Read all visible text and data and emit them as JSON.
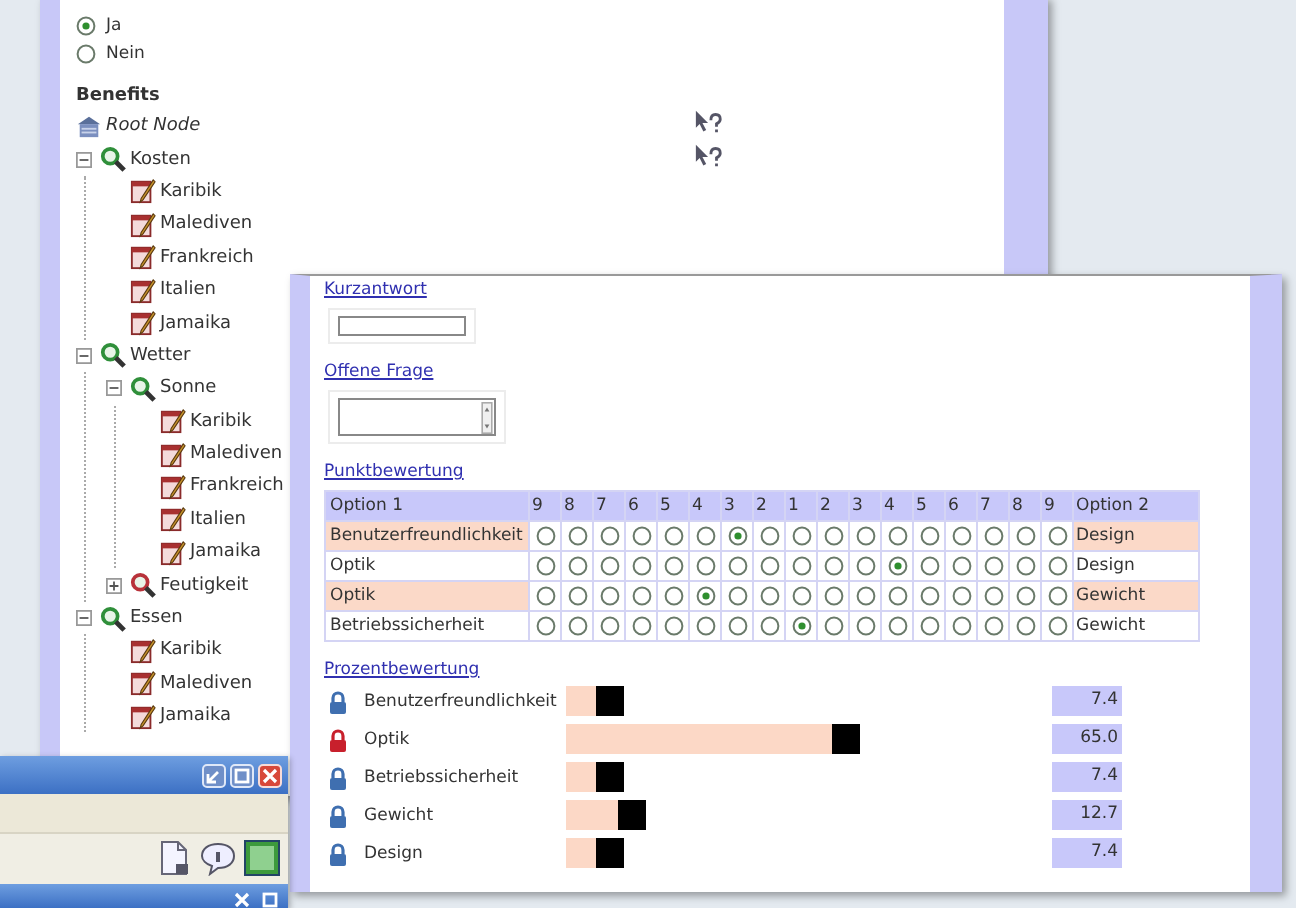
{
  "back_window": {
    "radios": [
      {
        "label": "Ja",
        "selected": true
      },
      {
        "label": "Nein",
        "selected": false
      }
    ],
    "tree": {
      "title": "Benefits",
      "root": {
        "label": "Root Node",
        "children": [
          {
            "kind": "category",
            "label": "Kosten",
            "expanded": true,
            "children": [
              {
                "kind": "item",
                "label": "Karibik"
              },
              {
                "kind": "item",
                "label": "Malediven"
              },
              {
                "kind": "item",
                "label": "Frankreich"
              },
              {
                "kind": "item",
                "label": "Italien"
              },
              {
                "kind": "item",
                "label": "Jamaika"
              }
            ]
          },
          {
            "kind": "category",
            "label": "Wetter",
            "expanded": true,
            "children": [
              {
                "kind": "category",
                "label": "Sonne",
                "expanded": true,
                "children": [
                  {
                    "kind": "item",
                    "label": "Karibik"
                  },
                  {
                    "kind": "item",
                    "label": "Malediven"
                  },
                  {
                    "kind": "item",
                    "label": "Frankreich"
                  },
                  {
                    "kind": "item",
                    "label": "Italien"
                  },
                  {
                    "kind": "item",
                    "label": "Jamaika"
                  }
                ]
              },
              {
                "kind": "category",
                "label": "Feutigkeit",
                "expanded": false
              }
            ]
          },
          {
            "kind": "category",
            "label": "Essen",
            "expanded": true,
            "children": [
              {
                "kind": "item",
                "label": "Karibik"
              },
              {
                "kind": "item",
                "label": "Malediven"
              },
              {
                "kind": "item",
                "label": "Jamaika"
              }
            ]
          }
        ]
      }
    }
  },
  "front_window": {
    "short_answer": {
      "label": "Kurzantwort"
    },
    "open_question": {
      "label": "Offene Frage"
    },
    "point_rating": {
      "title": "Punktbewertung",
      "columns": [
        "Option 1",
        "9",
        "8",
        "7",
        "6",
        "5",
        "4",
        "3",
        "2",
        "1",
        "2",
        "3",
        "4",
        "5",
        "6",
        "7",
        "8",
        "9",
        "Option 2"
      ],
      "rows": [
        {
          "option_1": "Benutzerfreundlichkeit",
          "option_2": "Design",
          "choices": [
            {
              "selected": false
            },
            {
              "selected": false
            },
            {
              "selected": false
            },
            {
              "selected": false
            },
            {
              "selected": false
            },
            {
              "selected": false
            },
            {
              "selected": true
            },
            {
              "selected": false
            },
            {
              "selected": false
            },
            {
              "selected": false
            },
            {
              "selected": false
            },
            {
              "selected": false
            },
            {
              "selected": false
            },
            {
              "selected": false
            },
            {
              "selected": false
            },
            {
              "selected": false
            },
            {
              "selected": false
            }
          ]
        },
        {
          "option_1": "Optik",
          "option_2": "Design",
          "choices": [
            {
              "selected": false
            },
            {
              "selected": false
            },
            {
              "selected": false
            },
            {
              "selected": false
            },
            {
              "selected": false
            },
            {
              "selected": false
            },
            {
              "selected": false
            },
            {
              "selected": false
            },
            {
              "selected": false
            },
            {
              "selected": false
            },
            {
              "selected": false
            },
            {
              "selected": true
            },
            {
              "selected": false
            },
            {
              "selected": false
            },
            {
              "selected": false
            },
            {
              "selected": false
            },
            {
              "selected": false
            }
          ]
        },
        {
          "option_1": "Optik",
          "option_2": "Gewicht",
          "choices": [
            {
              "selected": false
            },
            {
              "selected": false
            },
            {
              "selected": false
            },
            {
              "selected": false
            },
            {
              "selected": false
            },
            {
              "selected": true
            },
            {
              "selected": false
            },
            {
              "selected": false
            },
            {
              "selected": false
            },
            {
              "selected": false
            },
            {
              "selected": false
            },
            {
              "selected": false
            },
            {
              "selected": false
            },
            {
              "selected": false
            },
            {
              "selected": false
            },
            {
              "selected": false
            },
            {
              "selected": false
            }
          ]
        },
        {
          "option_1": "Betriebssicherheit",
          "option_2": "Gewicht",
          "choices": [
            {
              "selected": false
            },
            {
              "selected": false
            },
            {
              "selected": false
            },
            {
              "selected": false
            },
            {
              "selected": false
            },
            {
              "selected": false
            },
            {
              "selected": false
            },
            {
              "selected": false
            },
            {
              "selected": true
            },
            {
              "selected": false
            },
            {
              "selected": false
            },
            {
              "selected": false
            },
            {
              "selected": false
            },
            {
              "selected": false
            },
            {
              "selected": false
            },
            {
              "selected": false
            },
            {
              "selected": false
            }
          ]
        }
      ]
    },
    "percent_rating": {
      "title": "Prozentbewertung",
      "items": [
        {
          "label": "Benutzerfreundlichkeit",
          "color": "#3f6fb0",
          "level": 0.074,
          "value": "7.4"
        },
        {
          "label": "Optik",
          "color": "#c8202c",
          "level": 0.65,
          "value": "65.0"
        },
        {
          "label": "Betriebssicherheit",
          "color": "#3f6fb0",
          "level": 0.074,
          "value": "7.4"
        },
        {
          "label": "Gewicht",
          "color": "#3f6fb0",
          "level": 0.127,
          "value": "12.7"
        },
        {
          "label": "Design",
          "color": "#3f6fb0",
          "level": 0.074,
          "value": "7.4"
        }
      ]
    }
  }
}
